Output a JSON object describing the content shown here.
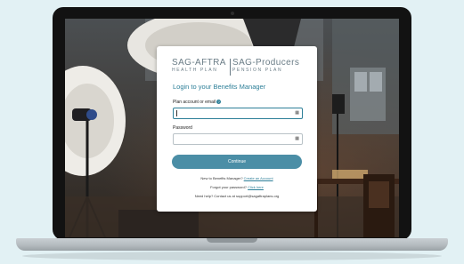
{
  "logo": {
    "left_main": "SAG-AFTRA",
    "left_sub": "HEALTH PLAN",
    "right_main": "SAG-Producers",
    "right_sub": "PENSION PLAN"
  },
  "login": {
    "title": "Login to your Benefits Manager",
    "username_label": "Plan account or email",
    "username_icon": "help-icon",
    "password_label": "Password",
    "continue_label": "Continue"
  },
  "footer": {
    "register_prompt": "New to Benefits Manager?",
    "register_link": "Create an Account",
    "forgot_prompt": "Forgot your password?",
    "forgot_link": "Click here",
    "help_text": "Need help? Contact us at support@sagaftraplans.org"
  }
}
